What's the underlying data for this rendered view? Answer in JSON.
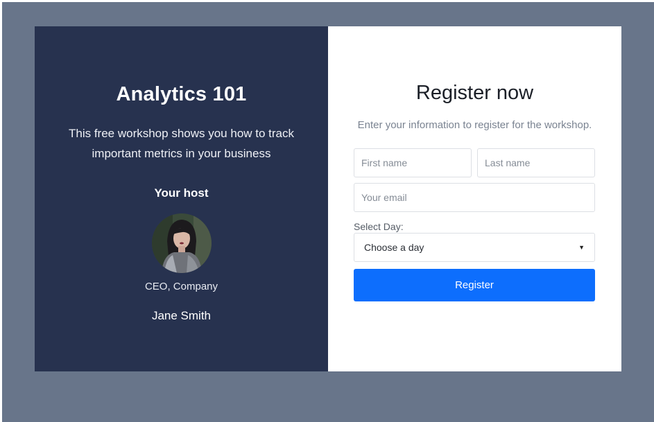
{
  "workshop": {
    "title": "Analytics 101",
    "description": "This free workshop shows you how to track important metrics in your business",
    "host_label": "Your host",
    "host_role": "CEO, Company",
    "host_name": "Jane Smith"
  },
  "register": {
    "title": "Register now",
    "subtitle": "Enter your information to register for the workshop.",
    "first_name_placeholder": "First name",
    "last_name_placeholder": "Last name",
    "email_placeholder": "Your email",
    "day_label": "Select Day:",
    "day_selected": "Choose a day",
    "submit_label": "Register"
  },
  "colors": {
    "backdrop": "#68758a",
    "left_panel": "#27324f",
    "button": "#0d6efd"
  }
}
